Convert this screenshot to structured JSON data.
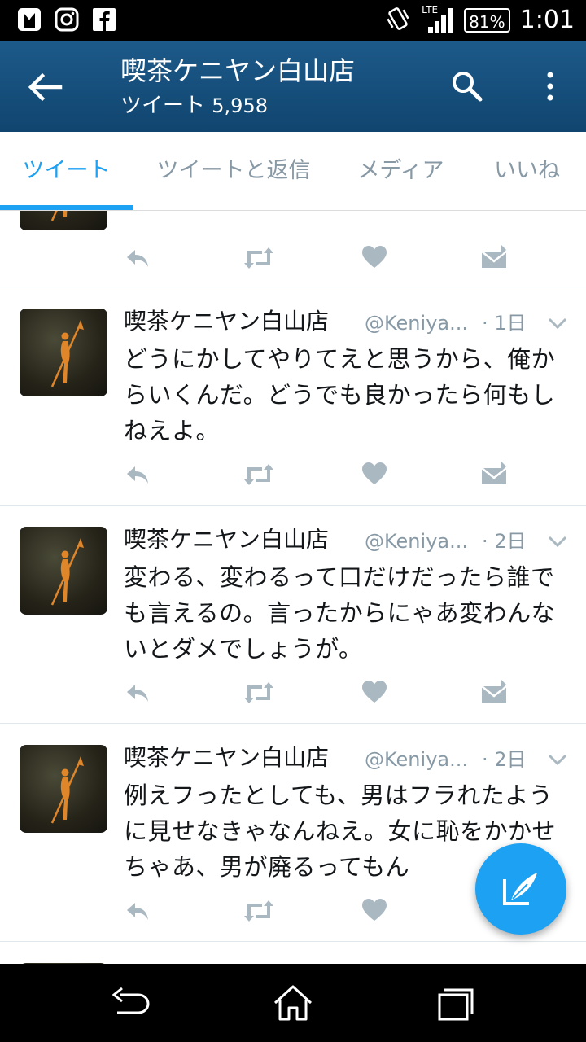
{
  "status_bar": {
    "left_icons": [
      "tuxedo-app-icon",
      "instagram-icon",
      "facebook-icon"
    ],
    "network": "LTE",
    "battery": "81%",
    "time": "1:01"
  },
  "app_bar": {
    "title": "喫茶ケニヤン白山店",
    "subtitle_label": "ツイート",
    "tweet_count": "5,958"
  },
  "tabs": [
    {
      "label": "ツイート",
      "active": true
    },
    {
      "label": "ツイートと返信",
      "active": false
    },
    {
      "label": "メディア",
      "active": false
    },
    {
      "label": "いいね",
      "active": false
    }
  ],
  "tweets": [
    {
      "name": "喫茶ケニヤン白山店",
      "handle": "@Keniya...",
      "time": "· 1日",
      "text": "どうにかしてやりてえと思うから、俺からいくんだ。どうでも良かったら何もしねえよ。"
    },
    {
      "name": "喫茶ケニヤン白山店",
      "handle": "@Keniya...",
      "time": "· 2日",
      "text": "変わる、変わるって口だけだったら誰でも言えるの。言ったからにゃあ変わんないとダメでしょうが。"
    },
    {
      "name": "喫茶ケニヤン白山店",
      "handle": "@Keniya...",
      "time": "· 2日",
      "text": "例えフったとしても、男はフラれたように見せなきゃなんねえ。女に恥をかかせちゃあ、男が廃るってもん"
    }
  ],
  "colors": {
    "app_bar": "#1d5a8a",
    "accent": "#1da1f2",
    "icon_gray": "#aab8c2"
  }
}
